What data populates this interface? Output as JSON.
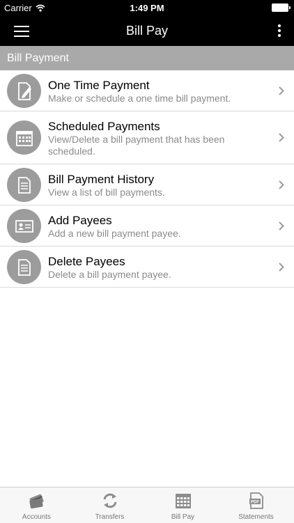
{
  "status_bar": {
    "carrier": "Carrier",
    "time": "1:49 PM"
  },
  "nav": {
    "title": "Bill Pay"
  },
  "section": {
    "title": "Bill Payment"
  },
  "items": [
    {
      "title": "One Time Payment",
      "subtitle": "Make or schedule a one time bill payment.",
      "icon": "pencil-document-icon"
    },
    {
      "title": "Scheduled Payments",
      "subtitle": "View/Delete a bill payment that has been scheduled.",
      "icon": "calendar-icon"
    },
    {
      "title": "Bill Payment History",
      "subtitle": "View a list of bill payments.",
      "icon": "document-list-icon"
    },
    {
      "title": "Add Payees",
      "subtitle": "Add a new bill payment payee.",
      "icon": "id-card-icon"
    },
    {
      "title": "Delete Payees",
      "subtitle": "Delete a bill payment payee.",
      "icon": "document-list-icon"
    }
  ],
  "tabs": [
    {
      "label": "Accounts",
      "icon": "cards-icon"
    },
    {
      "label": "Transfers",
      "icon": "refresh-arrows-icon"
    },
    {
      "label": "Bill Pay",
      "icon": "calendar-icon"
    },
    {
      "label": "Statements",
      "icon": "pdf-icon"
    }
  ],
  "colors": {
    "header": "#000000",
    "section_bg": "#a9a9a9",
    "icon_circle": "#9c9c9c",
    "subtitle": "#8a8a8a"
  }
}
